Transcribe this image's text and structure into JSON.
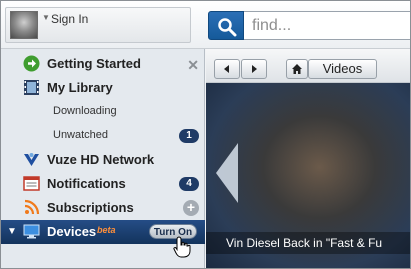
{
  "account": {
    "label": "Sign In"
  },
  "search": {
    "placeholder": "find..."
  },
  "sidebar": {
    "items": [
      {
        "label": "Getting Started"
      },
      {
        "label": "My Library"
      },
      {
        "label": "Downloading"
      },
      {
        "label": "Unwatched",
        "badge": "1"
      },
      {
        "label": "Vuze HD Network"
      },
      {
        "label": "Notifications",
        "badge": "4"
      },
      {
        "label": "Subscriptions"
      },
      {
        "label": "Devices",
        "tag": "beta",
        "button": "Turn On"
      }
    ]
  },
  "content": {
    "breadcrumb": "Videos",
    "caption": "Vin Diesel Back in \"Fast & Fu"
  },
  "colors": {
    "accent": "#1f3b66",
    "search_button": "#1f66ad",
    "beta": "#ff8f3a"
  }
}
